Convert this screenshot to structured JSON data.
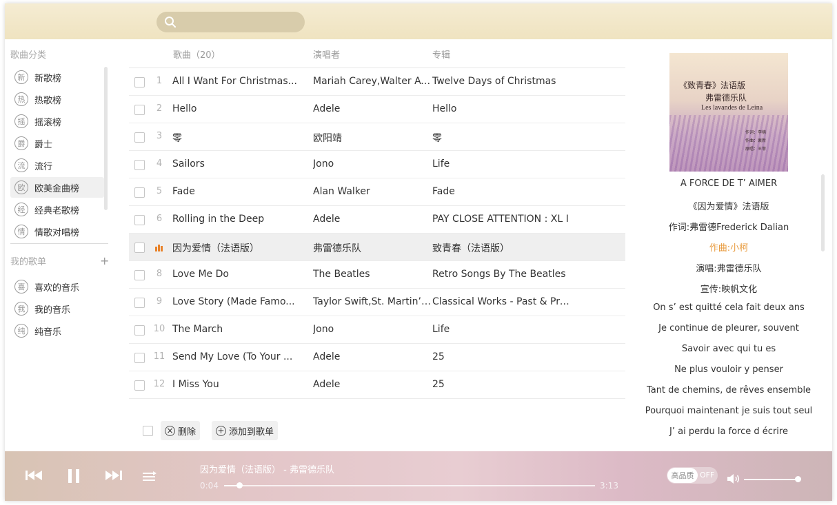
{
  "search": {
    "placeholder": ""
  },
  "sidebar": {
    "categories_title": "歌曲分类",
    "categories": [
      {
        "badge": "新",
        "label": "新歌榜"
      },
      {
        "badge": "热",
        "label": "热歌榜"
      },
      {
        "badge": "摇",
        "label": "摇滚榜"
      },
      {
        "badge": "爵",
        "label": "爵士"
      },
      {
        "badge": "流",
        "label": "流行"
      },
      {
        "badge": "欧",
        "label": "欧美金曲榜"
      },
      {
        "badge": "经",
        "label": "经典老歌榜"
      },
      {
        "badge": "情",
        "label": "情歌对唱榜"
      }
    ],
    "active_index": 5,
    "playlists_title": "我的歌单",
    "add_symbol": "+",
    "playlists": [
      {
        "badge": "喜",
        "label": "喜欢的音乐"
      },
      {
        "badge": "我",
        "label": "我的音乐"
      },
      {
        "badge": "纯",
        "label": "纯音乐"
      }
    ]
  },
  "list": {
    "header": {
      "song": "歌曲（20）",
      "artist": "演唱者",
      "album": "专辑"
    },
    "playing_index": 6,
    "rows": [
      {
        "num": "1",
        "title": "All I Want For Christmas...",
        "artist": "Mariah Carey,Walter Af...",
        "album": "Twelve Days of Christmas"
      },
      {
        "num": "2",
        "title": "Hello",
        "artist": "Adele",
        "album": "Hello"
      },
      {
        "num": "3",
        "title": "零",
        "artist": "欧阳靖",
        "album": "零"
      },
      {
        "num": "4",
        "title": "Sailors",
        "artist": "Jono",
        "album": "Life"
      },
      {
        "num": "5",
        "title": "Fade",
        "artist": "Alan Walker",
        "album": "Fade"
      },
      {
        "num": "6",
        "title": "Rolling in the Deep",
        "artist": "Adele",
        "album": "PAY CLOSE ATTENTION : XL I"
      },
      {
        "num": "",
        "title": "因为爱情（法语版）",
        "artist": "弗雷德乐队",
        "album": "致青春（法语版）"
      },
      {
        "num": "8",
        "title": "Love Me Do",
        "artist": "The Beatles",
        "album": "Retro Songs By The Beatles"
      },
      {
        "num": "9",
        "title": "Love Story (Made Famo...",
        "artist": "Taylor Swift,St. Martin’ ...",
        "album": "Classical Works - Past & Pres"
      },
      {
        "num": "10",
        "title": "The March",
        "artist": "Jono",
        "album": "Life"
      },
      {
        "num": "11",
        "title": "Send My Love (To Your ...",
        "artist": "Adele",
        "album": "25"
      },
      {
        "num": "12",
        "title": "I Miss You",
        "artist": "Adele",
        "album": "25"
      }
    ],
    "footer": {
      "delete_icon": "×",
      "delete_label": "删除",
      "add_icon": "+",
      "add_label": "添加到歌单"
    }
  },
  "cover": {
    "title_line1": "《致青春》法语版",
    "title_line2": "弗雷德乐队",
    "title_line3": "Les lavandes de Leina",
    "credits": [
      "作词：李楠",
      "作曲：栗新",
      "原唱：王菲"
    ]
  },
  "lyrics": {
    "lines": [
      "A FORCE DE T’ AIMER",
      "《因为爱情》法语版",
      "作词:弗雷德Frederick Dalian",
      "作曲:小柯",
      "演唱:弗雷德乐队",
      "宣传:映帆文化",
      "On s’ est quitté cela fait deux ans",
      "Je continue de pleurer, souvent",
      "Savoir avec qui tu es",
      "Ne plus vouloir y penser",
      "Tant de chemins, de rêves ensemble",
      "Pourquoi maintenant je suis tout seul",
      "J’ ai perdu la force d écrire"
    ],
    "highlight_index": 3,
    "highlight_color": "#e89a3c"
  },
  "player": {
    "now_playing": "因为爱情（法语版） - 弗雷德乐队",
    "current_time": "0:04",
    "total_time": "3:13",
    "progress": 0.04,
    "quality_label": "高品质",
    "quality_state": "OFF",
    "volume": 0.98,
    "icons": [
      "previous-icon",
      "pause-icon",
      "next-icon",
      "playlist-mode-icon",
      "volume-icon"
    ]
  },
  "colors": {
    "accent": "#e89a3c",
    "playing_eq": "#e8822a"
  }
}
